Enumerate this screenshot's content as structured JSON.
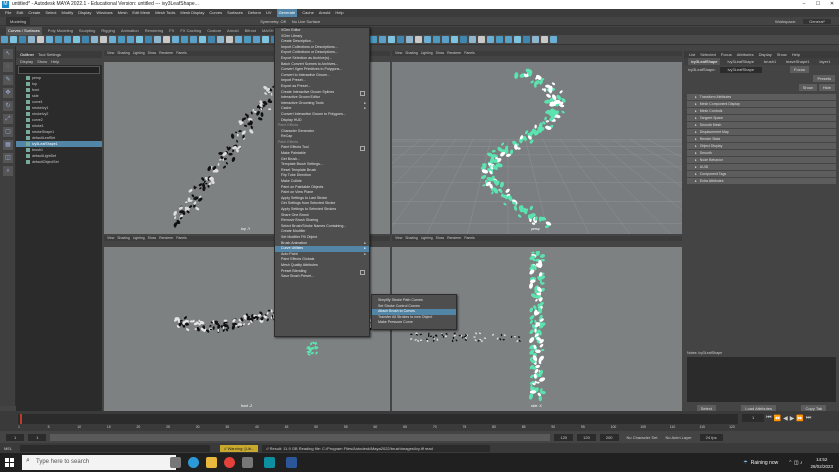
{
  "window": {
    "title": "untitled* - Autodesk MAYA 2022.1 - Educational Version: untitled   ---   ivy3LeafShape...",
    "logo": "M",
    "controls": [
      "–",
      "☐",
      "✕"
    ]
  },
  "menubar": [
    "File",
    "Edit",
    "Create",
    "Select",
    "Modify",
    "Display",
    "Windows",
    "Mesh",
    "Edit Mesh",
    "Mesh Tools",
    "Mesh Display",
    "Curves",
    "Surfaces",
    "Deform",
    "UV",
    "Generate",
    "Cache",
    "Arnold",
    "Help"
  ],
  "menubar_active_index": 15,
  "statusline": {
    "mode": "Modeling",
    "symmetry": "Symmetry: Off",
    "live": "No Live Surface",
    "workspace_label": "Workspace:",
    "workspace": "General*"
  },
  "shelf_tabs": [
    "Curves / Surfaces",
    "Poly Modeling",
    "Sculpting",
    "Rigging",
    "Animation",
    "Rendering",
    "FX",
    "FX Caching",
    "Custom",
    "Arnold",
    "Bifrost",
    "MASH",
    "Motion Graphics",
    "XGen"
  ],
  "outliner": {
    "tabs": [
      "Outliner",
      "Tool Settings"
    ],
    "menu": [
      "Display",
      "Show",
      "Help"
    ],
    "items": [
      {
        "label": "persp",
        "sel": false
      },
      {
        "label": "top",
        "sel": false
      },
      {
        "label": "front",
        "sel": false
      },
      {
        "label": "side",
        "sel": false
      },
      {
        "label": "curve1",
        "sel": false
      },
      {
        "label": "strokeIvy1",
        "sel": false
      },
      {
        "label": "strokeIvy2",
        "sel": false
      },
      {
        "label": "curve2",
        "sel": false
      },
      {
        "label": "stroke1",
        "sel": false
      },
      {
        "label": "strokeShape1",
        "sel": false
      },
      {
        "label": "defaultLeafSet",
        "sel": false
      },
      {
        "label": "ivy3LeafShape1",
        "sel": true
      },
      {
        "label": "brush1",
        "sel": false
      },
      {
        "label": "defaultLightSet",
        "sel": false
      },
      {
        "label": "defaultObjectSet",
        "sel": false
      }
    ]
  },
  "viewport_menu": [
    "View",
    "Shading",
    "Lighting",
    "Show",
    "Renderer",
    "Panels"
  ],
  "viewports": [
    {
      "label": "top -Y"
    },
    {
      "label": "persp"
    },
    {
      "label": "front -Z"
    },
    {
      "label": "side -X"
    }
  ],
  "generate_menu": [
    {
      "label": "XGen Editor",
      "type": "item"
    },
    {
      "label": "XGen Library",
      "type": "item"
    },
    {
      "label": "Create Description...",
      "type": "item"
    },
    {
      "label": "Import Collections or Descriptions...",
      "type": "item"
    },
    {
      "label": "Export Collections or Descriptions...",
      "type": "item"
    },
    {
      "label": "Export Selection as Archive(s)...",
      "type": "item"
    },
    {
      "label": "Batch Convert Scenes to Archives...",
      "type": "item"
    },
    {
      "label": "Convert Xgen Primitives to Polygons...",
      "type": "item"
    },
    {
      "label": "Convert to Interactive Groom...",
      "type": "item"
    },
    {
      "label": "Import Preset...",
      "type": "item"
    },
    {
      "label": "Export as Preset...",
      "type": "item"
    },
    {
      "label": "Create Interactive Groom Splines",
      "type": "box"
    },
    {
      "label": "Interactive Groom Editor",
      "type": "item"
    },
    {
      "label": "Interactive Grooming Tools",
      "type": "arrow"
    },
    {
      "label": "Cache",
      "type": "arrow"
    },
    {
      "label": "Convert Interactive Groom to Polygons...",
      "type": "item"
    },
    {
      "label": "Display HUD",
      "type": "item"
    },
    {
      "label": "Paint Effects",
      "type": "section"
    },
    {
      "label": "Character Generator",
      "type": "item"
    },
    {
      "label": "ReCap",
      "type": "item"
    },
    {
      "label": "Paint Effects",
      "type": "section"
    },
    {
      "label": "Paint Effects Tool",
      "type": "box"
    },
    {
      "label": "Make Paintable",
      "type": "item"
    },
    {
      "label": "Get Brush...",
      "type": "item"
    },
    {
      "label": "Template Brush Settings...",
      "type": "item"
    },
    {
      "label": "Reset Template Brush",
      "type": "item"
    },
    {
      "label": "Flip Tube Direction",
      "type": "item"
    },
    {
      "label": "Make Collide",
      "type": "item"
    },
    {
      "label": "Paint on Paintable Objects",
      "type": "item"
    },
    {
      "label": "Paint on View Plane",
      "type": "item"
    },
    {
      "label": "Apply Settings to Last Stroke",
      "type": "item"
    },
    {
      "label": "Get Settings from Selected Stroke",
      "type": "item"
    },
    {
      "label": "Apply Settings to Selected Strokes",
      "type": "item"
    },
    {
      "label": "Share One Brush",
      "type": "item"
    },
    {
      "label": "Remove Brush Sharing",
      "type": "item"
    },
    {
      "label": "Select Brush/Stroke Names Containing...",
      "type": "item"
    },
    {
      "label": "Create Modifier",
      "type": "item"
    },
    {
      "label": "Set Modifier Fill Object",
      "type": "item"
    },
    {
      "label": "Brush Animation",
      "type": "arrow"
    },
    {
      "label": "Curve Utilities",
      "type": "arrow",
      "hi": true
    },
    {
      "label": "Auto Paint",
      "type": "arrow"
    },
    {
      "label": "Paint Effects Globals",
      "type": "item"
    },
    {
      "label": "Mesh Quality Attributes",
      "type": "item"
    },
    {
      "label": "Preset Blending",
      "type": "box"
    },
    {
      "label": "Save Brush Preset...",
      "type": "item"
    }
  ],
  "curve_utilities_menu": [
    {
      "label": "Simplify Stroke Path Curves",
      "hi": false
    },
    {
      "label": "Set Stroke Control Curves",
      "hi": false
    },
    {
      "label": "Attach Brush to Curves",
      "hi": true
    },
    {
      "label": "Transfer All Strokes to new Object",
      "hi": false
    },
    {
      "label": "Make Pressure Curve",
      "hi": false
    }
  ],
  "attribute_editor": {
    "tabs": [
      "List",
      "Selected",
      "Focus",
      "Attributes",
      "Display",
      "Show",
      "Help"
    ],
    "node_tabs": [
      "ivy3LeafShape",
      "ivy3LeafShape",
      "brush1",
      "leaveShape1",
      "layer1"
    ],
    "node_label": "ivy3LeafShape:",
    "node_value": "ivy3LeafShape",
    "buttons": [
      "Focus",
      "Presets",
      "Show",
      "Hide"
    ],
    "sections": [
      "Transform Attributes",
      "Mesh Component Display",
      "Mesh Controls",
      "Tangent Space",
      "Smooth Mesh",
      "Displacement Map",
      "Render Stats",
      "Object Display",
      "Smooth",
      "Node Behavior",
      "UUID",
      "Component Tags",
      "Extra Attributes"
    ],
    "notes_label": "Notes:  ivy3LeafShape",
    "footer": [
      "Select",
      "Load Attributes",
      "Copy Tab"
    ]
  },
  "timeslider": {
    "ticks": [
      "1",
      "5",
      "10",
      "15",
      "20",
      "25",
      "30",
      "35",
      "40",
      "45",
      "50",
      "55",
      "60",
      "65",
      "70",
      "75",
      "80",
      "85",
      "90",
      "95",
      "100",
      "105",
      "110",
      "115",
      "120"
    ],
    "current": "1"
  },
  "rangebar": {
    "start": "1",
    "start2": "1",
    "end": "120",
    "end2": "120",
    "end3": "200",
    "character": "No Character Set",
    "anim_layer": "No Anim Layer",
    "fps": "24 fps"
  },
  "cmdline": {
    "lang": "MEL",
    "warning": "// Warning: [Lib...",
    "result": "// Result: 11.9 GB Reading file: C:/Program Files/Autodesk/Maya2022/brushImages/ivy.iff read "
  },
  "taskbar": {
    "search_placeholder": "Type here to search",
    "weather": "Raining now",
    "time": "14:52",
    "date": "28/02/2023"
  },
  "colors": {
    "accent": "#5285a6",
    "foliage": "#5be3b0",
    "viewport_bg": "#7d8182"
  }
}
